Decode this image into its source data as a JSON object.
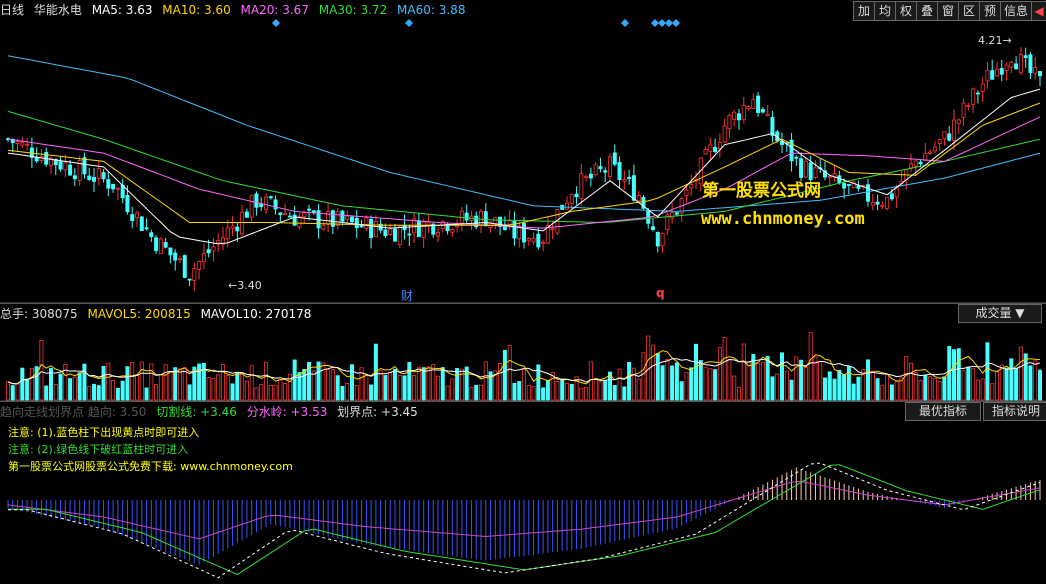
{
  "top": {
    "period": "日线",
    "stock": "华能水电",
    "ma": [
      {
        "label": "MA5: 3.63",
        "color": "#ffffff"
      },
      {
        "label": "MA10: 3.60",
        "color": "#ffd700"
      },
      {
        "label": "MA20: 3.67",
        "color": "#ff66ff"
      },
      {
        "label": "MA30: 3.72",
        "color": "#33dd33"
      },
      {
        "label": "MA60: 3.88",
        "color": "#44bbff"
      }
    ],
    "buttons": [
      "加",
      "均",
      "权",
      "叠",
      "窗",
      "区",
      "预",
      "信息"
    ]
  },
  "price": {
    "low_label": "3.40",
    "high_label": "4.21",
    "marker_cai": "财",
    "marker_q": "q"
  },
  "volume": {
    "total": "总手: 308075",
    "mavol5": "MAVOL5: 200815",
    "mavol10": "MAVOL10: 270178",
    "dropdown": "成交量"
  },
  "indicator": {
    "name": "趋向走线划界点 趋向: 3.50",
    "qie": "切割线: +3.46",
    "fen": "分水岭: +3.53",
    "hua": "划界点: +3.45",
    "btn_best": "最优指标",
    "btn_help": "指标说明",
    "note1": "注意: (1).蓝色柱下出现黄点时即可进入",
    "note2": "注意: (2).绿色线下破红蓝柱时可进入",
    "note3": "第一股票公式网股票公式免费下载: www.chnmoney.com"
  },
  "watermark": {
    "line1": "第一股票公式网",
    "line2": "www.chnmoney.com"
  },
  "colors": {
    "up": "#ff3333",
    "down": "#44ffff",
    "ma5": "#ffffff",
    "ma10": "#ffd700",
    "ma20": "#ff66ff",
    "ma30": "#33dd33",
    "ma60": "#44bbff"
  },
  "chart_data": {
    "type": "line",
    "price_range": [
      3.35,
      4.3
    ],
    "price_points": [
      [
        0,
        3.9
      ],
      [
        10,
        3.82
      ],
      [
        22,
        3.74
      ],
      [
        30,
        3.55
      ],
      [
        38,
        3.42
      ],
      [
        45,
        3.55
      ],
      [
        52,
        3.68
      ],
      [
        60,
        3.62
      ],
      [
        70,
        3.6
      ],
      [
        80,
        3.57
      ],
      [
        90,
        3.6
      ],
      [
        100,
        3.62
      ],
      [
        106,
        3.56
      ],
      [
        112,
        3.55
      ],
      [
        118,
        3.72
      ],
      [
        126,
        3.8
      ],
      [
        132,
        3.7
      ],
      [
        136,
        3.55
      ],
      [
        142,
        3.7
      ],
      [
        150,
        3.95
      ],
      [
        156,
        4.05
      ],
      [
        160,
        3.92
      ],
      [
        166,
        3.8
      ],
      [
        172,
        3.75
      ],
      [
        178,
        3.7
      ],
      [
        184,
        3.68
      ],
      [
        190,
        3.82
      ],
      [
        196,
        3.9
      ],
      [
        204,
        4.1
      ],
      [
        210,
        4.21
      ],
      [
        216,
        4.1
      ]
    ],
    "ma5_points": [
      [
        0,
        3.85
      ],
      [
        20,
        3.8
      ],
      [
        35,
        3.55
      ],
      [
        45,
        3.52
      ],
      [
        60,
        3.62
      ],
      [
        80,
        3.58
      ],
      [
        100,
        3.6
      ],
      [
        112,
        3.57
      ],
      [
        126,
        3.75
      ],
      [
        136,
        3.62
      ],
      [
        150,
        3.88
      ],
      [
        160,
        3.92
      ],
      [
        172,
        3.77
      ],
      [
        184,
        3.7
      ],
      [
        196,
        3.86
      ],
      [
        210,
        4.05
      ],
      [
        216,
        4.08
      ]
    ],
    "ma10_points": [
      [
        0,
        3.86
      ],
      [
        20,
        3.82
      ],
      [
        38,
        3.6
      ],
      [
        55,
        3.6
      ],
      [
        80,
        3.59
      ],
      [
        105,
        3.59
      ],
      [
        118,
        3.64
      ],
      [
        135,
        3.68
      ],
      [
        150,
        3.8
      ],
      [
        162,
        3.9
      ],
      [
        176,
        3.78
      ],
      [
        190,
        3.77
      ],
      [
        204,
        3.95
      ],
      [
        216,
        4.03
      ]
    ],
    "ma20_points": [
      [
        0,
        3.9
      ],
      [
        20,
        3.85
      ],
      [
        40,
        3.72
      ],
      [
        60,
        3.64
      ],
      [
        90,
        3.6
      ],
      [
        112,
        3.58
      ],
      [
        135,
        3.62
      ],
      [
        150,
        3.72
      ],
      [
        164,
        3.85
      ],
      [
        180,
        3.84
      ],
      [
        196,
        3.82
      ],
      [
        216,
        3.98
      ]
    ],
    "ma30_points": [
      [
        0,
        4.0
      ],
      [
        20,
        3.9
      ],
      [
        45,
        3.75
      ],
      [
        70,
        3.66
      ],
      [
        100,
        3.61
      ],
      [
        125,
        3.6
      ],
      [
        150,
        3.64
      ],
      [
        176,
        3.75
      ],
      [
        196,
        3.82
      ],
      [
        216,
        3.9
      ]
    ],
    "ma60_points": [
      [
        0,
        4.2
      ],
      [
        25,
        4.12
      ],
      [
        50,
        3.95
      ],
      [
        80,
        3.78
      ],
      [
        110,
        3.66
      ],
      [
        140,
        3.64
      ],
      [
        170,
        3.68
      ],
      [
        196,
        3.76
      ],
      [
        216,
        3.85
      ]
    ],
    "price_axis_labels": [
      "3.40",
      "4.21"
    ]
  }
}
